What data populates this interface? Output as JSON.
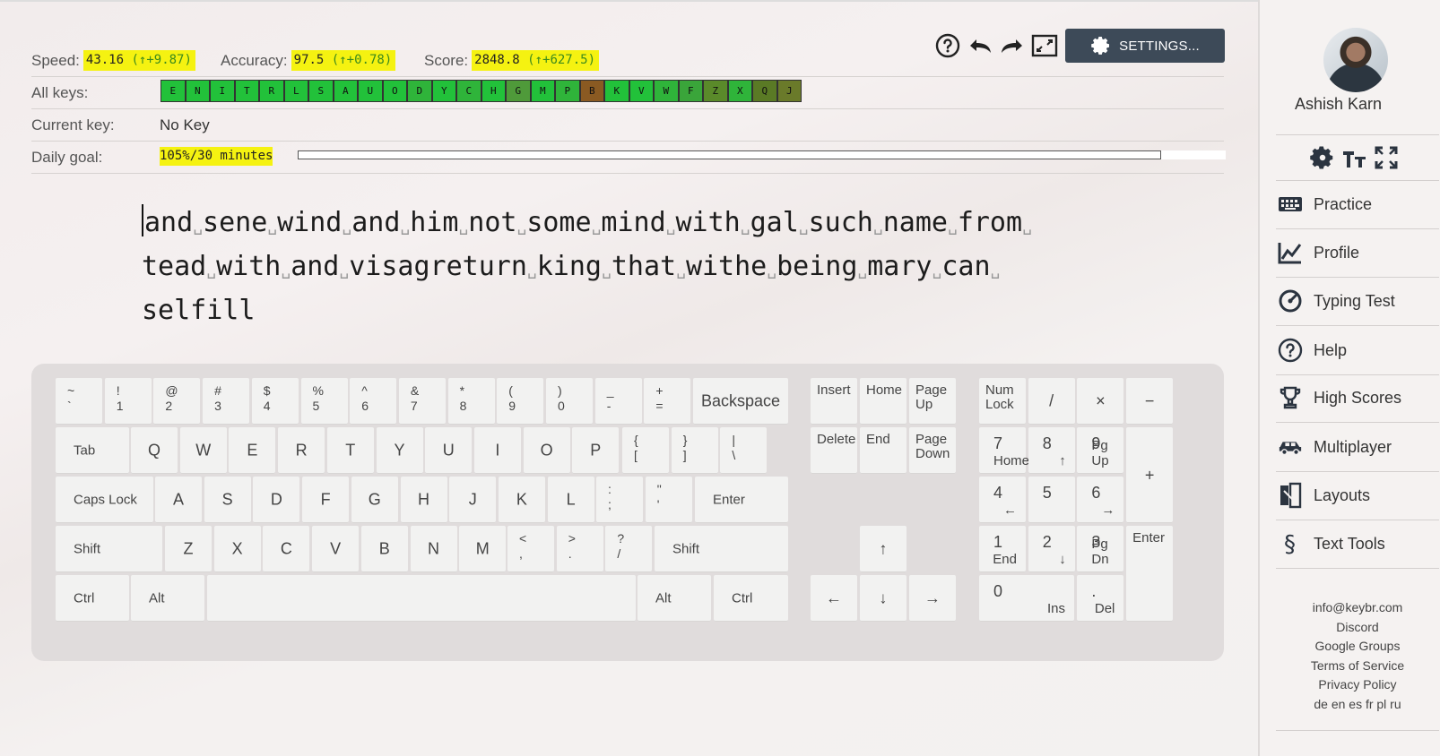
{
  "stats": {
    "speed_label": "Speed:",
    "speed_value": "43.16",
    "speed_delta": "(↑+9.87)",
    "accuracy_label": "Accuracy:",
    "accuracy_value": "97.5",
    "accuracy_delta": "(↑+0.78)",
    "score_label": "Score:",
    "score_value": "2848.8",
    "score_delta": "(↑+627.5)",
    "all_keys_label": "All keys:",
    "current_key_label": "Current key:",
    "current_key_value": "No Key",
    "daily_goal_label": "Daily goal:",
    "daily_goal_value": "105%/30 minutes",
    "daily_goal_progress": 0.93
  },
  "all_keys": [
    {
      "k": "E",
      "color": "#22c13a"
    },
    {
      "k": "N",
      "color": "#22c13a"
    },
    {
      "k": "I",
      "color": "#22c13a"
    },
    {
      "k": "T",
      "color": "#22c13a"
    },
    {
      "k": "R",
      "color": "#22c13a"
    },
    {
      "k": "L",
      "color": "#22c13a"
    },
    {
      "k": "S",
      "color": "#22c13a"
    },
    {
      "k": "A",
      "color": "#22c13a"
    },
    {
      "k": "U",
      "color": "#22c13a"
    },
    {
      "k": "O",
      "color": "#22c13a"
    },
    {
      "k": "D",
      "color": "#2fb43a"
    },
    {
      "k": "Y",
      "color": "#22c13a"
    },
    {
      "k": "C",
      "color": "#2fb43a"
    },
    {
      "k": "H",
      "color": "#22c13a"
    },
    {
      "k": "G",
      "color": "#4f9a3a"
    },
    {
      "k": "M",
      "color": "#22c13a"
    },
    {
      "k": "P",
      "color": "#2fb43a"
    },
    {
      "k": "B",
      "color": "#8a5a22"
    },
    {
      "k": "K",
      "color": "#22c13a"
    },
    {
      "k": "V",
      "color": "#22c13a"
    },
    {
      "k": "W",
      "color": "#2fb43a"
    },
    {
      "k": "F",
      "color": "#3aa53a"
    },
    {
      "k": "Z",
      "color": "#5a8a2a"
    },
    {
      "k": "X",
      "color": "#2fb43a"
    },
    {
      "k": "Q",
      "color": "#5a7a25"
    },
    {
      "k": "J",
      "color": "#6a7a2a"
    }
  ],
  "toolbar": {
    "settings_label": "SETTINGS...",
    "help_icon": "help-circle-icon",
    "undo_icon": "undo-icon",
    "redo_icon": "redo-icon",
    "fullscreen_icon": "fullscreen-icon"
  },
  "typing": {
    "lines": [
      [
        "and",
        "sene",
        "wind",
        "and",
        "him",
        "not",
        "some",
        "mind",
        "with",
        "gal",
        "such",
        "name",
        "from",
        ""
      ],
      [
        "tead",
        "with",
        "and",
        "visagreturn",
        "king",
        "that",
        "withe",
        "being",
        "mary",
        "can",
        ""
      ],
      [
        "selfill"
      ]
    ]
  },
  "keyboard": {
    "row1": [
      [
        "~",
        "`"
      ],
      [
        "!",
        "1"
      ],
      [
        "@",
        "2"
      ],
      [
        "#",
        "3"
      ],
      [
        "$",
        "4"
      ],
      [
        "%",
        "5"
      ],
      [
        "^",
        "6"
      ],
      [
        "&",
        "7"
      ],
      [
        "*",
        "8"
      ],
      [
        "(",
        "9"
      ],
      [
        ")",
        "0"
      ],
      [
        "_",
        "-"
      ],
      [
        "+",
        "="
      ]
    ],
    "backspace": "Backspace",
    "tab": "Tab",
    "row2": [
      "Q",
      "W",
      "E",
      "R",
      "T",
      "Y",
      "U",
      "I",
      "O",
      "P"
    ],
    "row2_sym": [
      [
        "{",
        "["
      ],
      [
        "}",
        "]"
      ],
      [
        "|",
        "\\"
      ]
    ],
    "caps": "Caps Lock",
    "row3": [
      "A",
      "S",
      "D",
      "F",
      "G",
      "H",
      "J",
      "K",
      "L"
    ],
    "row3_sym": [
      [
        ":",
        ";"
      ],
      [
        "\"",
        "'"
      ]
    ],
    "enter": "Enter",
    "shift": "Shift",
    "row4": [
      "Z",
      "X",
      "C",
      "V",
      "B",
      "N",
      "M"
    ],
    "row4_sym": [
      [
        "<",
        ","
      ],
      [
        ">",
        "."
      ],
      [
        "?",
        "/"
      ]
    ],
    "ctrl": "Ctrl",
    "alt": "Alt",
    "nav": {
      "insert": "Insert",
      "home": "Home",
      "pageup": "Page Up",
      "delete": "Delete",
      "end": "End",
      "pagedown": "Page Down"
    },
    "arrows": {
      "up": "↑",
      "left": "←",
      "down": "↓",
      "right": "→"
    },
    "numpad": {
      "numlock": "Num Lock",
      "divide": "/",
      "multiply": "×",
      "minus": "−",
      "plus": "+",
      "enter": "Enter",
      "n7": "7",
      "n7b": "Home",
      "n8": "8",
      "n8b": "↑",
      "n9": "9",
      "n9b": "Pg Up",
      "n4": "4",
      "n4b": "←",
      "n5": "5",
      "n6": "6",
      "n6b": "→",
      "n1": "1",
      "n1b": "End",
      "n2": "2",
      "n2b": "↓",
      "n3": "3",
      "n3b": "Pg Dn",
      "n0": "0",
      "n0b": "Ins",
      "ndot": ".",
      "ndotb": "Del"
    }
  },
  "sidebar": {
    "username": "Ashish Karn",
    "nav": [
      {
        "label": "Practice",
        "icon": "keyboard-icon"
      },
      {
        "label": "Profile",
        "icon": "chart-icon"
      },
      {
        "label": "Typing Test",
        "icon": "speedometer-icon"
      },
      {
        "label": "Help",
        "icon": "help-circle-icon"
      },
      {
        "label": "High Scores",
        "icon": "trophy-icon"
      },
      {
        "label": "Multiplayer",
        "icon": "car-icon"
      },
      {
        "label": "Layouts",
        "icon": "layouts-icon"
      },
      {
        "label": "Text Tools",
        "icon": "section-icon"
      }
    ],
    "links": [
      "info@keybr.com",
      "Discord",
      "Google Groups",
      "Terms of Service",
      "Privacy Policy"
    ],
    "languages": "de en es fr pl ru"
  }
}
